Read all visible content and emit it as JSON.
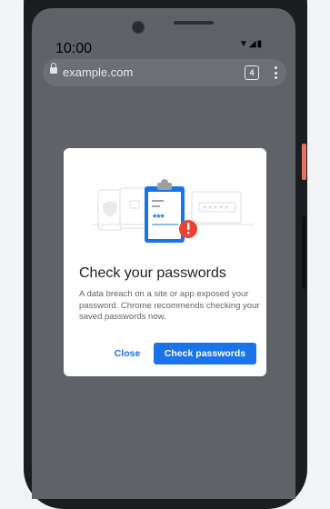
{
  "status_bar": {
    "time": "10:00"
  },
  "url_bar": {
    "url": "example.com",
    "tab_count": "4"
  },
  "dialog": {
    "title": "Check your passwords",
    "body": "A data breach on a site or app exposed your password. Chrome recommends checking your saved passwords now.",
    "close_label": "Close",
    "check_label": "Check passwords",
    "illustration": {
      "mask": "***"
    }
  },
  "colors": {
    "accent": "#1a73e8",
    "warning": "#ea4335",
    "scrim": "#5f6368"
  }
}
